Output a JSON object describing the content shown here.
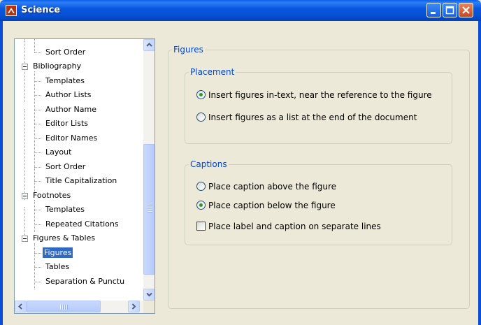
{
  "window": {
    "title": "Science"
  },
  "tree": {
    "items": [
      {
        "label": "Sort Order"
      },
      {
        "label": "Bibliography"
      },
      {
        "label": "Templates"
      },
      {
        "label": "Author Lists"
      },
      {
        "label": "Author Name"
      },
      {
        "label": "Editor Lists"
      },
      {
        "label": "Editor Names"
      },
      {
        "label": "Layout"
      },
      {
        "label": "Sort Order"
      },
      {
        "label": "Title Capitalization"
      },
      {
        "label": "Footnotes"
      },
      {
        "label": "Templates"
      },
      {
        "label": "Repeated Citations"
      },
      {
        "label": "Figures & Tables"
      },
      {
        "label": "Figures"
      },
      {
        "label": "Tables"
      },
      {
        "label": "Separation & Punctu"
      }
    ],
    "selected": "Figures"
  },
  "figures_group": {
    "title": "Figures"
  },
  "placement": {
    "title": "Placement",
    "options": [
      {
        "label": "Insert figures in-text, near the reference to the figure",
        "checked": true
      },
      {
        "label": "Insert figures as a list at the end of the document",
        "checked": false
      }
    ]
  },
  "captions": {
    "title": "Captions",
    "options": [
      {
        "label": "Place caption above the figure",
        "checked": false
      },
      {
        "label": "Place caption below the figure",
        "checked": true
      }
    ],
    "checkbox": {
      "label": "Place label and caption on separate lines",
      "checked": false
    }
  },
  "icons": {
    "app": "app-icon",
    "minimize": "minimize-icon",
    "maximize": "maximize-icon",
    "close": "close-icon",
    "scroll_up": "arrow-up-icon",
    "scroll_down": "arrow-down-icon",
    "scroll_left": "arrow-left-icon",
    "scroll_right": "arrow-right-icon"
  },
  "colors": {
    "titlebar": "#0a5fe8",
    "selection": "#316ac5",
    "group_title": "#0046d5",
    "radio_dot": "#21a121"
  }
}
